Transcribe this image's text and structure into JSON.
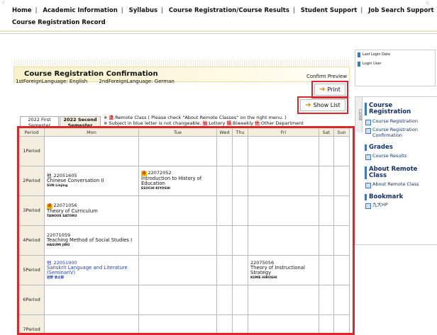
{
  "nav": {
    "items": [
      "Home",
      "Academic Information",
      "Syllabus",
      "Course Registration/Course Results",
      "Student Support",
      "Job Search Support"
    ],
    "row2": "Course Registration Record"
  },
  "page": {
    "title": "Course Registration Confirmation",
    "first_lang": "1stForeignLanguage: English",
    "second_lang": "2ndForeignLanguage: German",
    "confirm_preview": "Confirm Preview",
    "print_label": "Print",
    "show_list_label": "Show List"
  },
  "semesters": {
    "first": [
      "2022 First",
      "Semester"
    ],
    "second": [
      "2022 Second",
      "Semester"
    ]
  },
  "notes": {
    "line1_a": "※ ",
    "line1_badge": "遠",
    "line1_b": ":Remote Class ( Please check \"About Remote Classes\" on the right menu. )",
    "line2_a": "※ Subject in blue letter is not changeable. ",
    "line2_b": "抽",
    "line2_c": ":Lottery ",
    "line2_d": "隔",
    "line2_e": ":Biweekly ",
    "line2_f": "他",
    "line2_g": ":Other Department"
  },
  "grid": {
    "headers": [
      "Period",
      "Mon",
      "Tue",
      "Wed",
      "Thu",
      "Fri",
      "Sat",
      "Sun"
    ],
    "periods": [
      "1Period",
      "2Period",
      "3Period",
      "4Period",
      "5Period",
      "6Period",
      "7Period"
    ],
    "cells": {
      "p2_mon": {
        "tag": "他",
        "code": "22051605",
        "title": "Chinese Conversation II",
        "teacher": "SUN Linjing"
      },
      "p2_tue": {
        "badge": "遠",
        "code": "22072052",
        "title": "Introduction to History of Education",
        "teacher": "ESUCHI KIYOSHI"
      },
      "p3_mon": {
        "badge": "遠",
        "code": "22071056",
        "title": "Theory of Curriculum",
        "teacher": "TANOUE SATORU"
      },
      "p4_mon": {
        "code": "22071059",
        "title": "Teaching Method of Social Studies I",
        "teacher": "HASUMI JIRO"
      },
      "p5_mon": {
        "tag": "他",
        "code": "22051900",
        "title": "Sanskrit Language and Literature (SeminarIV)",
        "teacher": "岩野 承太郎"
      },
      "p5_fri": {
        "code": "22075056",
        "title": "Theory of Instructional Strategy",
        "teacher": "KUME HIROSHI"
      }
    }
  },
  "side": {
    "last_login": "Last Login Date",
    "login_user": "Login User",
    "close": "CLOSE",
    "sections": {
      "course_reg": "Course Registration",
      "grades": "Grades",
      "remote": "About Remote Class",
      "bookmark": "Bookmark"
    },
    "links": {
      "course_reg": "Course Registration",
      "course_reg_confirm": "Course Registration Confirmation",
      "course_results": "Course Results",
      "about_remote": "About Remote Class",
      "kyudai": "九大HP"
    }
  },
  "colors": {
    "accent_red": "#e0262a",
    "nav_blue": "#12306a",
    "badge_yellow": "#f5c400"
  }
}
